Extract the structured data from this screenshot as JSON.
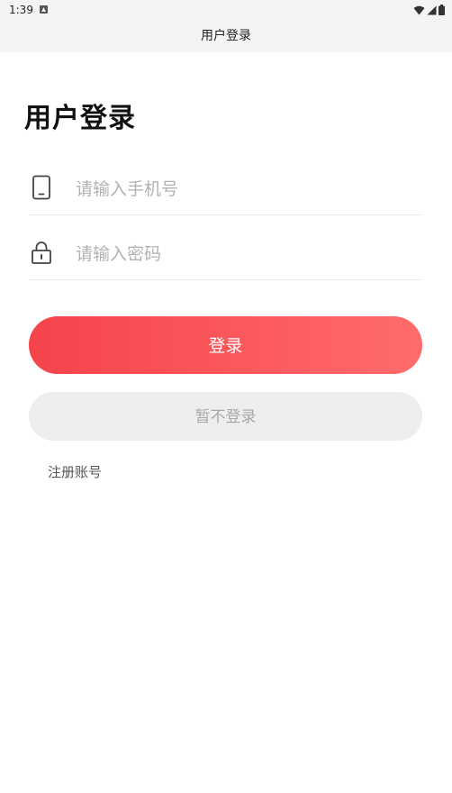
{
  "status_bar": {
    "time": "1:39"
  },
  "header": {
    "title": "用户登录"
  },
  "main": {
    "heading": "用户登录",
    "phone": {
      "placeholder": "请输入手机号",
      "icon": "phone-icon"
    },
    "password": {
      "placeholder": "请输入密码",
      "icon": "lock-icon"
    },
    "login_label": "登录",
    "skip_label": "暂不登录",
    "register_label": "注册账号"
  },
  "colors": {
    "accent_start": "#f6434b",
    "accent_end": "#ff6b6b",
    "secondary_button": "#eeeeee"
  }
}
